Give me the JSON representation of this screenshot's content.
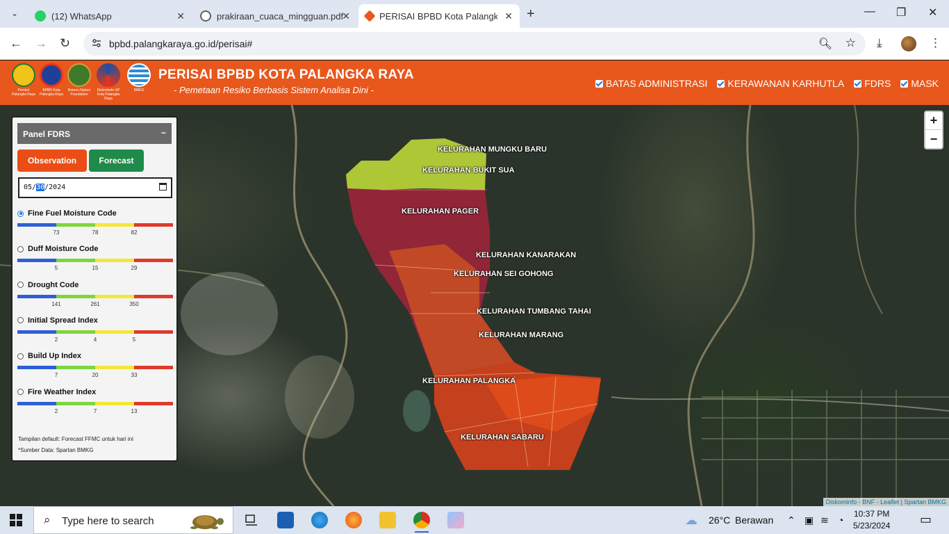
{
  "browser": {
    "tabs": [
      {
        "title": "(12) WhatsApp",
        "icon": "whatsapp-icon",
        "color": "#25d366"
      },
      {
        "title": "prakiraan_cuaca_mingguan.pdf",
        "icon": "globe-icon",
        "color": "#5f6368"
      },
      {
        "title": "PERISAI BPBD Kota Palangka Ra",
        "icon": "bpbd-icon",
        "color": "#e8571c"
      }
    ],
    "url": "bpbd.palangkaraya.go.id/perisai#"
  },
  "header": {
    "logos": [
      {
        "caption": "Pemkot Palangka Raya",
        "color": "#f0c419"
      },
      {
        "caption": "BPBD Kota Palangka Raya",
        "color": "#e3351b"
      },
      {
        "caption": "Borneo Nature Foundation",
        "color": "#3f7a2a"
      },
      {
        "caption": "Diskominfo-SP Kota Palangka Raya",
        "color": "#1f4fa0"
      },
      {
        "caption": "BMKG",
        "color": "#2d8bd1"
      }
    ],
    "title": "PERISAI BPBD KOTA PALANGKA RAYA",
    "subtitle": "- Pemetaan Resiko Berbasis Sistem Analisa Dini -",
    "layers": [
      "BATAS ADMINISTRASI",
      "KERAWANAN KARHUTLA",
      "FDRS",
      "MASK"
    ]
  },
  "map": {
    "kelurahan": [
      "KELURAHAN MUNGKU BARU",
      "KELURAHAN BUKIT SUA",
      "KELURAHAN PAGER",
      "KELURAHAN KANARAKAN",
      "KELURAHAN SEI GOHONG",
      "KELURAHAN TUMBANG TAHAI",
      "KELURAHAN MARANG",
      "KELURAHAN PALANGKA",
      "KELURAHAN SABARU"
    ],
    "zoom_in": "+",
    "zoom_out": "−",
    "attribution": "Diskominfo - BNF - Leaflet | Spartan BMKG"
  },
  "panel": {
    "title": "Panel FDRS",
    "minimize": "−",
    "observation": "Observation",
    "forecast": "Forecast",
    "date": {
      "month": "05",
      "day": "30",
      "year": "2024"
    },
    "scale_colors": [
      "#2e5fd6",
      "#7fd63a",
      "#f2e83a",
      "#e03a2a"
    ],
    "indices": [
      {
        "name": "Fine Fuel Moisture Code",
        "selected": true,
        "ticks": [
          "73",
          "78",
          "82"
        ]
      },
      {
        "name": "Duff Moisture Code",
        "selected": false,
        "ticks": [
          "5",
          "15",
          "29"
        ]
      },
      {
        "name": "Drought Code",
        "selected": false,
        "ticks": [
          "141",
          "261",
          "350"
        ]
      },
      {
        "name": "Initial Spread Index",
        "selected": false,
        "ticks": [
          "2",
          "4",
          "5"
        ]
      },
      {
        "name": "Build Up Index",
        "selected": false,
        "ticks": [
          "7",
          "20",
          "33"
        ]
      },
      {
        "name": "Fire Weather Index",
        "selected": false,
        "ticks": [
          "2",
          "7",
          "13"
        ]
      }
    ],
    "note1": "Tampilan default: Forecast FFMC untuk hari ini",
    "note2": "*Sumber Data: Spartan BMKG"
  },
  "taskbar": {
    "search_placeholder": "Type here to search",
    "weather_temp": "26°C",
    "weather_text": "Berawan",
    "time": "10:37 PM",
    "date": "5/23/2024"
  }
}
